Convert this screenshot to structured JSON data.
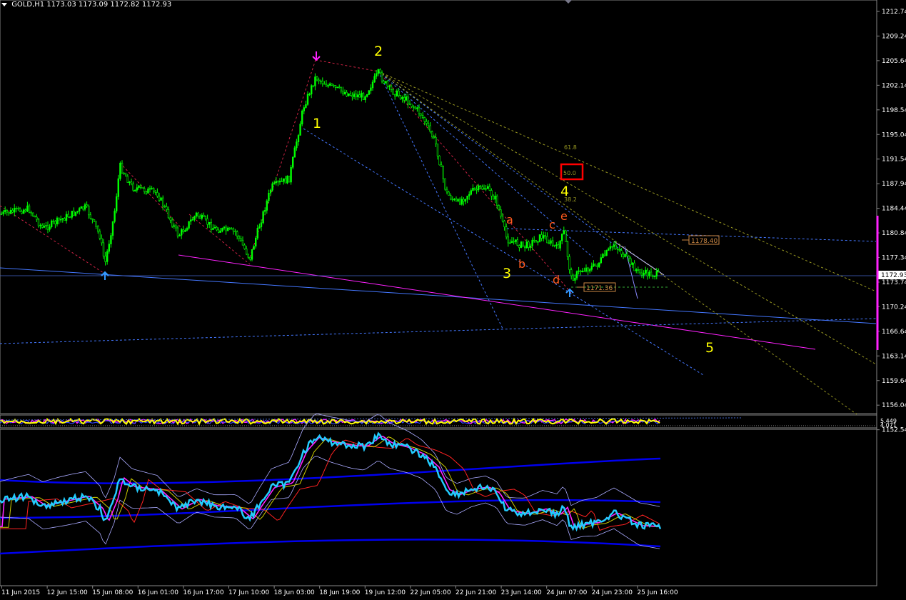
{
  "header": {
    "symbol": "GOLD,H1",
    "ohlc": "1173.03 1173.09 1172.82 1172.93"
  },
  "price_axis": {
    "labels": [
      "1212.74",
      "1209.24",
      "1205.64",
      "1202.14",
      "1198.54",
      "1195.04",
      "1191.54",
      "1187.94",
      "1184.44",
      "1180.84",
      "1177.34",
      "1173.74",
      "1170.24",
      "1166.64",
      "1163.14",
      "1159.64",
      "1156.04",
      "1152.54"
    ],
    "current_price": "1172.93"
  },
  "time_axis": {
    "labels": [
      "11 Jun 2015",
      "12 Jun 15:00",
      "15 Jun 08:00",
      "16 Jun 01:00",
      "16 Jun 17:00",
      "17 Jun 10:00",
      "18 Jun 03:00",
      "18 Jun 19:00",
      "19 Jun 12:00",
      "22 Jun 05:00",
      "22 Jun 21:00",
      "23 Jun 14:00",
      "24 Jun 07:00",
      "24 Jun 23:00",
      "25 Jun 16:00"
    ]
  },
  "wave_labels": {
    "w1": "1",
    "w2": "2",
    "w3": "3",
    "w4": "4",
    "w5": "5",
    "wa": "a",
    "wb": "b",
    "wc": "c",
    "wd": "d",
    "we": "e"
  },
  "fib_labels": {
    "f618": "61.8",
    "f50": "50.0",
    "f382": "38.2"
  },
  "price_tags": {
    "tag1": "1178.40",
    "tag2": "1171.36"
  },
  "indicator": {
    "text": "5.449",
    "text2": "4.071"
  },
  "colors": {
    "candle": "#00ff00",
    "wave_num": "#ffff00",
    "wave_letter": "#ff5a1e",
    "magenta": "#ff22ff",
    "blue": "#4477ff",
    "grid_text": "#ffffff",
    "fib_box": "#ff0000",
    "osc_main": "#22ccff",
    "osc_band": "#0000ee"
  }
}
